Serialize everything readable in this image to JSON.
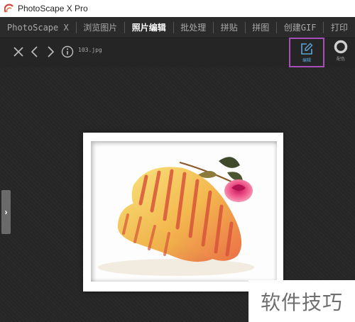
{
  "window": {
    "title": "PhotoScape X Pro"
  },
  "menu": {
    "tabs": [
      "PhotoScape X",
      "浏览图片",
      "照片编辑",
      "批处理",
      "拼贴",
      "拼图",
      "创建GIF",
      "打印"
    ],
    "active_index": 2
  },
  "toolbar": {
    "filename": "103.jpg",
    "edit_label": "编辑",
    "color_label": "配色"
  },
  "watermark": {
    "text": "软件技巧"
  },
  "colors": {
    "highlight_border": "#a54fb6",
    "edit_icon": "#5ba6d8",
    "background": "#2a2a2a"
  },
  "icons": [
    "app-logo-icon",
    "close-icon",
    "chevron-left-icon",
    "chevron-right-icon",
    "info-icon",
    "edit-icon",
    "color-ring-icon",
    "chevron-right-handle-icon"
  ]
}
